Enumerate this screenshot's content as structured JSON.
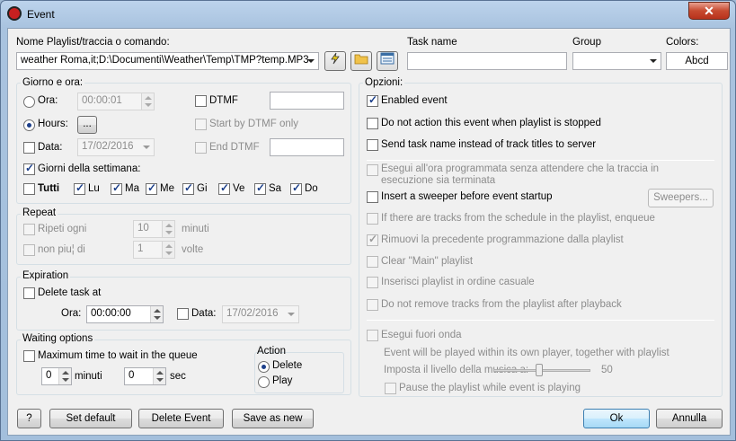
{
  "window": {
    "title": "Event",
    "close_glyph": "✕"
  },
  "playlist": {
    "label": "Nome Playlist/traccia o comando:",
    "value": "weather Roma,it;D:\\Documenti\\Weather\\Temp\\TMP?temp.MP3"
  },
  "task": {
    "label": "Task name",
    "value": ""
  },
  "group": {
    "label": "Group",
    "value": ""
  },
  "colors": {
    "label": "Colors:",
    "button": "Abcd"
  },
  "schedule": {
    "title": "Giorno e ora:",
    "ora_label": "Ora:",
    "ora_value": "00:00:01",
    "hours_label": "Hours:",
    "hours_button": "...",
    "data_label": "Data:",
    "data_value": "17/02/2016",
    "dtmf_label": "DTMF",
    "start_dtmf_label": "Start by DTMF only",
    "end_dtmf_label": "End DTMF",
    "weekdays_label": "Giorni della settimana:",
    "days": [
      "Tutti",
      "Lu",
      "Ma",
      "Me",
      "Gi",
      "Ve",
      "Sa",
      "Do"
    ]
  },
  "repeat": {
    "title": "Repeat",
    "every_label": "Ripeti ogni",
    "every_value": "10",
    "every_unit": "minuti",
    "max_label": "non piu¦ di",
    "max_value": "1",
    "max_unit": "volte"
  },
  "expiration": {
    "title": "Expiration",
    "delete_label": "Delete task at",
    "ora_label": "Ora:",
    "ora_value": "00:00:00",
    "data_label": "Data:",
    "data_value": "17/02/2016"
  },
  "waiting": {
    "title": "Waiting options",
    "max_label": "Maximum time to wait in the queue",
    "min_value": "0",
    "min_unit": "minuti",
    "sec_value": "0",
    "sec_unit": "sec",
    "action_title": "Action",
    "delete_label": "Delete",
    "play_label": "Play"
  },
  "options": {
    "title": "Opzioni:",
    "enabled": "Enabled event",
    "no_action_stopped": "Do not action this event when playlist is stopped",
    "send_task_name": "Send task name instead of track titles to server",
    "exec_no_wait": "Esegui all'ora programmata senza attendere che la traccia in esecuzione sia terminata",
    "sweeper": "Insert a sweeper before event startup",
    "sweepers_button": "Sweepers...",
    "tracks_enqueue": "If there are tracks from the schedule in the playlist, enqueue",
    "rimuovi": "Rimuovi la precedente programmazione dalla playlist",
    "clear_main": "Clear \"Main\" playlist",
    "inserisci_casuale": "Inserisci playlist in ordine casuale",
    "no_remove": "Do not remove tracks from the playlist after playback",
    "fuori_onda": "Esegui fuori onda",
    "own_player_note": "Event will be played within its own player, together with playlist",
    "volume_label": "Imposta il livello della musica a:",
    "volume_value": "50",
    "pause_playlist": "Pause the playlist while event is playing"
  },
  "buttons": {
    "help": "?",
    "set_default": "Set default",
    "delete_event": "Delete Event",
    "save_as_new": "Save as new",
    "ok": "Ok",
    "cancel": "Annulla"
  }
}
